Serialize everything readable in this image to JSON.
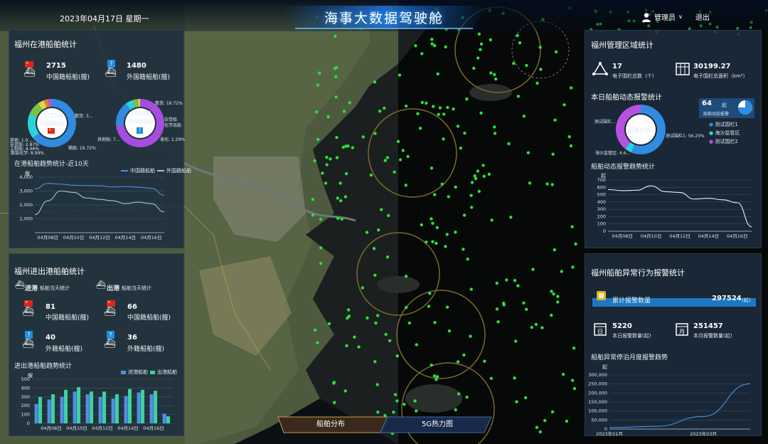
{
  "header": {
    "title": "海事大数据驾驶舱",
    "date": "2023年04月17日 星期一",
    "user": "管理员",
    "user_arrow": "∨",
    "logout": "退出"
  },
  "tabs": [
    {
      "label": "船舶分布",
      "active": true
    },
    {
      "label": "5G热力图",
      "active": false
    }
  ],
  "in_port": {
    "title": "福州在港船舶统计",
    "domestic": {
      "count": "2715",
      "label": "中国籍船舶(艘)"
    },
    "foreign": {
      "count": "1480",
      "label": "外国籍船舶(艘)"
    },
    "donut_domestic": {
      "center_value": "2715艘",
      "center_label": "中国籍船舶",
      "slices": [
        {
          "name": "散货船",
          "value": 64.5,
          "color": "#2f8ce0",
          "text": "散货: 3..."
        },
        {
          "name": "集装箱",
          "value": 16.72,
          "color": "#2bd4d8",
          "text": "箱船: 16.72%"
        },
        {
          "name": "散装化学品",
          "value": 8.99,
          "color": "#7cc242",
          "text": "散装化学: 8.99%"
        },
        {
          "name": "工程船",
          "value": 4.46,
          "color": "#e6d24a",
          "text": "工程船: 4.46%"
        },
        {
          "name": "杂货船",
          "value": 2.87,
          "color": "#e07a3a",
          "text": "杂货船: 2.87%"
        },
        {
          "name": "其他船",
          "value": 2.46,
          "color": "#b552e0",
          "text": "其他: 1.0..."
        }
      ]
    },
    "donut_foreign": {
      "center_value": "1480艘",
      "center_label": "外国籍船舶",
      "slices": [
        {
          "name": "集装箱船",
          "value": 72.1,
          "color": "#a64de0",
          "text": "其他船: 7..."
        },
        {
          "name": "液货船",
          "value": 16.72,
          "color": "#2f8ce0",
          "text": "散货: 16.72%"
        },
        {
          "name": "杂货船",
          "value": 5.12,
          "color": "#2bd4d8",
          "text": "杂货船"
        },
        {
          "name": "化学品船",
          "value": 3.4,
          "color": "#7cc242",
          "text": "化学品船"
        },
        {
          "name": "其他",
          "value": 1.38,
          "color": "#e6d24a",
          "text": "液化: 1.29%"
        }
      ]
    },
    "trend_title": "在港船舶趋势统计-近10天",
    "trend_unit": "艘",
    "legend": [
      "中国籍船舶",
      "外国籍船舶"
    ]
  },
  "in_out": {
    "title": "福州进出港船舶统计",
    "in_label": "进港",
    "in_sub": "船舶当天统计",
    "out_label": "出港",
    "out_sub": "船舶当天统计",
    "in_domestic": {
      "count": "81",
      "label": "中国籍船舶(艘)"
    },
    "out_domestic": {
      "count": "66",
      "label": "中国籍船舶(艘)"
    },
    "in_foreign": {
      "count": "40",
      "label": "外籍船舶(艘)"
    },
    "out_foreign": {
      "count": "36",
      "label": "外籍船舶(艘)"
    },
    "trend_title": "进出港船舶趋势统计",
    "trend_unit": "艘",
    "legend": [
      "进港船舶",
      "出港船舶"
    ]
  },
  "area": {
    "title": "福州管理区域统计",
    "fence_count": "17",
    "fence_count_label": "电子围栏总数（个）",
    "fence_area": "30199.27",
    "fence_area_label": "电子围栏总面积（km²）"
  },
  "alarm_today": {
    "title": "本日船舶动态报警统计",
    "donut_center": "报警分布",
    "total": "64",
    "total_unit": "起",
    "total_label": "船舶动态报警",
    "slices": [
      {
        "name": "测试围栏1",
        "value": 56.25,
        "color": "#2f8ce0",
        "text": "测试围栏1: 56.25%"
      },
      {
        "name": "海沙监管区",
        "value": 4.6,
        "color": "#2bd4d8",
        "text": "海沙监管区: 4.6..."
      },
      {
        "name": "测试围栏2",
        "value": 39.15,
        "color": "#b552e0",
        "text": "测试围栏..."
      }
    ],
    "legend": [
      "测试围栏1",
      "海沙监管区",
      "测试围栏2"
    ],
    "trend_title": "船舶动态报警趋势统计",
    "trend_unit": "起"
  },
  "abnormal": {
    "title": "福州船舶异常行为报警统计",
    "total_label": "累计报警数量",
    "total_value": "297524",
    "total_unit": "(起)",
    "today_value": "5220",
    "today_label": "本日报警数量(起)",
    "month_value": "251457",
    "month_label": "本月报警数量(起)",
    "trend_title": "船舶异常停泊月度报警趋势",
    "trend_unit": "起"
  },
  "chart_data": [
    {
      "type": "line",
      "title": "在港船舶趋势统计-近10天",
      "ylabel": "艘",
      "x": [
        "04月07日",
        "04月08日",
        "04月09日",
        "04月10日",
        "04月11日",
        "04月12日",
        "04月13日",
        "04月14日",
        "04月15日",
        "04月16日",
        "04月17日"
      ],
      "x_ticks": [
        "04月08日",
        "04月10日",
        "04月12日",
        "04月14日",
        "04月16日"
      ],
      "ylim": [
        0,
        4000
      ],
      "y_ticks": [
        "4,000",
        "3,000",
        "2,000",
        "1,000"
      ],
      "series": [
        {
          "name": "中国籍船舶",
          "values": [
            3150,
            3550,
            3500,
            3420,
            3400,
            3380,
            3300,
            3320,
            3280,
            3200,
            2700
          ],
          "color": "#4a90e2"
        },
        {
          "name": "外国籍船舶",
          "values": [
            1300,
            2300,
            3000,
            2900,
            2500,
            2400,
            2300,
            2100,
            2200,
            2100,
            1500
          ],
          "color": "#8fd3c8"
        }
      ]
    },
    {
      "type": "bar",
      "title": "进出港船舶趋势统计",
      "ylabel": "艘",
      "categories": [
        "04月07日",
        "04月08日",
        "04月09日",
        "04月10日",
        "04月11日",
        "04月12日",
        "04月13日",
        "04月14日",
        "04月15日",
        "04月16日",
        "04月17日"
      ],
      "x_ticks": [
        "04月08日",
        "04月10日",
        "04月12日",
        "04月14日",
        "04月16日"
      ],
      "ylim": [
        0,
        500
      ],
      "y_ticks": [
        "500",
        "400",
        "300",
        "200",
        "100",
        "0"
      ],
      "series": [
        {
          "name": "进港船舶",
          "values": [
            220,
            270,
            300,
            360,
            330,
            300,
            280,
            310,
            350,
            330,
            110
          ],
          "color": "#4f8fe6"
        },
        {
          "name": "出港船舶",
          "values": [
            300,
            330,
            380,
            410,
            360,
            360,
            330,
            390,
            380,
            370,
            80
          ],
          "color": "#3ed19f"
        }
      ]
    },
    {
      "type": "line",
      "title": "船舶动态报警趋势统计",
      "ylabel": "起",
      "x": [
        "04月07日",
        "04月08日",
        "04月09日",
        "04月10日",
        "04月11日",
        "04月12日",
        "04月13日",
        "04月14日",
        "04月15日",
        "04月16日",
        "04月17日"
      ],
      "x_ticks": [
        "04月08日",
        "04月10日",
        "04月12日",
        "04月14日",
        "04月16日"
      ],
      "ylim": [
        0,
        700
      ],
      "y_ticks": [
        "700",
        "600",
        "500",
        "400",
        "300",
        "200",
        "100",
        "0"
      ],
      "series": [
        {
          "name": "报警",
          "values": [
            570,
            555,
            560,
            620,
            540,
            530,
            440,
            450,
            430,
            390,
            60
          ],
          "color": "#e8f2f8"
        }
      ]
    },
    {
      "type": "line",
      "title": "船舶异常停泊月度报警趋势",
      "ylabel": "起",
      "x": [
        "2023年01月",
        "2023年02月",
        "2023年03月",
        "2023年04月"
      ],
      "x_ticks": [
        "2023年01月",
        "2023年03月"
      ],
      "ylim": [
        0,
        300000
      ],
      "y_ticks": [
        "300,000",
        "250,000",
        "200,000",
        "150,000",
        "100,000",
        "50,000",
        "0"
      ],
      "series": [
        {
          "name": "报警",
          "values": [
            8000,
            15000,
            70000,
            251457
          ],
          "color": "#4a90e2"
        }
      ]
    }
  ]
}
